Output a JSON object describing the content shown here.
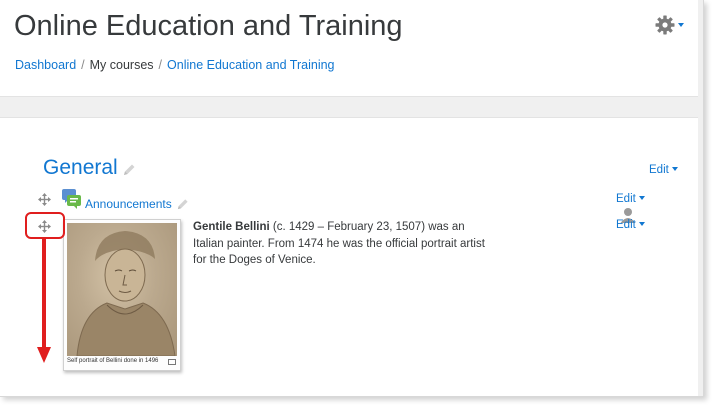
{
  "page": {
    "title": "Online Education and Training"
  },
  "breadcrumb": {
    "items": [
      {
        "label": "Dashboard",
        "link": true
      },
      {
        "label": "My courses",
        "link": false
      },
      {
        "label": "Online Education and Training",
        "link": true
      }
    ],
    "separator": "/"
  },
  "section": {
    "title": "General",
    "edit_label": "Edit"
  },
  "activities": [
    {
      "name": "Announcements",
      "icon": "forum-icon",
      "edit_label": "Edit"
    }
  ],
  "label_item": {
    "edit_label": "Edit",
    "image_caption": "Self portrait of Bellini done in 1496",
    "bio_bold": "Gentile Bellini",
    "bio_text": " (c. 1429 – February 23, 1507) was an Italian painter. From 1474 he was the official portrait artist for the Doges of Venice."
  },
  "colors": {
    "link": "#1177d1",
    "text": "#373a3c",
    "annotation": "#e01e1e",
    "background": "#f0f0f0"
  },
  "icons": [
    "gear-icon",
    "move-icon",
    "pencil-icon",
    "forum-icon",
    "user-icon",
    "caret-down-icon"
  ]
}
